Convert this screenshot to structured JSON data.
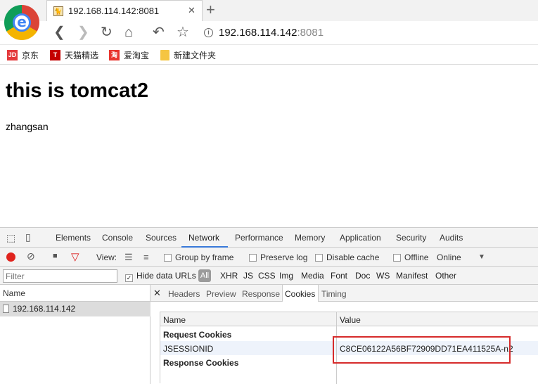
{
  "browser": {
    "tab_title": "192.168.114.142:8081",
    "address_host": "192.168.114.142",
    "address_port": ":8081",
    "bookmarks": [
      {
        "label": "京东",
        "icon": "jd-icon",
        "color": "#e4393c",
        "glyph": "JD"
      },
      {
        "label": "天猫精选",
        "icon": "tmall-icon",
        "color": "#c40000",
        "glyph": "T"
      },
      {
        "label": "爱淘宝",
        "icon": "taobao-icon",
        "color": "#e8352e",
        "glyph": "淘"
      },
      {
        "label": "新建文件夹",
        "icon": "folder-icon",
        "color": "#f5c542",
        "glyph": ""
      }
    ]
  },
  "page": {
    "heading": "this is tomcat2",
    "text": "zhangsan"
  },
  "devtools": {
    "tabs": [
      "Elements",
      "Console",
      "Sources",
      "Network",
      "Performance",
      "Memory",
      "Application",
      "Security",
      "Audits"
    ],
    "active_tab": "Network",
    "toolbar": {
      "view_label": "View:",
      "group_by_frame": "Group by frame",
      "preserve_log": "Preserve log",
      "disable_cache": "Disable cache",
      "offline": "Offline",
      "throttle": "Online"
    },
    "filter": {
      "placeholder": "Filter",
      "hide_data_urls": "Hide data URLs",
      "types": [
        "All",
        "XHR",
        "JS",
        "CSS",
        "Img",
        "Media",
        "Font",
        "Doc",
        "WS",
        "Manifest",
        "Other"
      ]
    },
    "request_list": {
      "header": "Name",
      "rows": [
        "192.168.114.142"
      ]
    },
    "detail_tabs": [
      "Headers",
      "Preview",
      "Response",
      "Cookies",
      "Timing"
    ],
    "active_detail_tab": "Cookies",
    "cookies": {
      "col_name": "Name",
      "col_value": "Value",
      "request_section": "Request Cookies",
      "rows": [
        {
          "name": "JSESSIONID",
          "value": "C8CE06122A56BF72909DD71EA411525A-n2"
        }
      ],
      "response_section": "Response Cookies"
    }
  },
  "colors": {
    "accent": "#3879d9",
    "highlight": "#d62b2b",
    "record": "#e0231d"
  }
}
